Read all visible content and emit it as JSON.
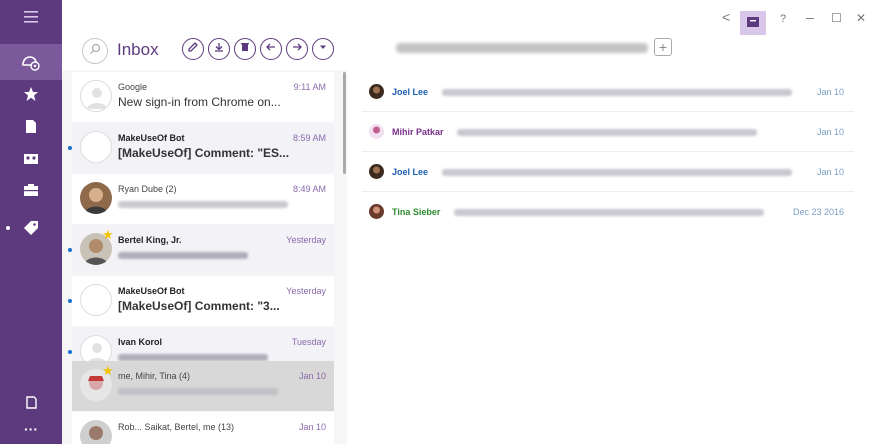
{
  "window": {
    "back_glyph": "<",
    "help_glyph": "?",
    "minimize_glyph": "–",
    "maximize_glyph": "☐",
    "close_glyph": "✕"
  },
  "rail": {
    "items": [
      {
        "icon": "hamburger-menu-icon"
      },
      {
        "icon": "people-icon"
      },
      {
        "icon": "star-icon"
      },
      {
        "icon": "document-icon"
      },
      {
        "icon": "group-icon"
      },
      {
        "icon": "briefcase-icon"
      },
      {
        "icon": "tag-icon"
      },
      {
        "icon": "compose-icon"
      },
      {
        "icon": "more-icon"
      }
    ],
    "more_label": "···"
  },
  "inbox": {
    "title": "Inbox",
    "tools": [
      "compose-icon",
      "download-icon",
      "delete-icon",
      "reply-icon",
      "forward-icon",
      "more-down-icon"
    ],
    "messages": [
      {
        "sender": "Google",
        "time": "9:11 AM",
        "subject": "New sign-in from Chrome on..."
      },
      {
        "sender": "MakeUseOf Bot",
        "time": "8:59 AM",
        "subject": "[MakeUseOf] Comment: \"ES..."
      },
      {
        "sender": "Ryan Dube  (2)",
        "time": "8:49 AM"
      },
      {
        "sender": "Bertel King, Jr.",
        "time": "Yesterday"
      },
      {
        "sender": "MakeUseOf Bot",
        "time": "Yesterday",
        "subject": "[MakeUseOf] Comment: \"3..."
      },
      {
        "sender": "Ivan Korol",
        "time": "Tuesday"
      },
      {
        "sender": "me, Mihir, Tina  (4)",
        "time": "Jan 10"
      },
      {
        "sender": "Rob... Saikat, Bertel, me  (13)",
        "time": "Jan 10"
      }
    ]
  },
  "conversation": {
    "add_glyph": "+",
    "rows": [
      {
        "name": "Joel Lee",
        "date": "Jan 10",
        "name_color": "#1a5fb4"
      },
      {
        "name": "Mihir Patkar",
        "date": "Jan 10",
        "name_color": "#7a2f8a"
      },
      {
        "name": "Joel Lee",
        "date": "Jan 10",
        "name_color": "#1a5fb4"
      },
      {
        "name": "Tina Sieber",
        "date": "Dec 23 2016",
        "name_color": "#2f8a2f"
      }
    ]
  },
  "colors": {
    "rail": "#5d3a7e",
    "accent": "#5d3a7e",
    "time": "#8a6aab",
    "unread_dot": "#1a6fd0",
    "star": "#f4c400"
  }
}
